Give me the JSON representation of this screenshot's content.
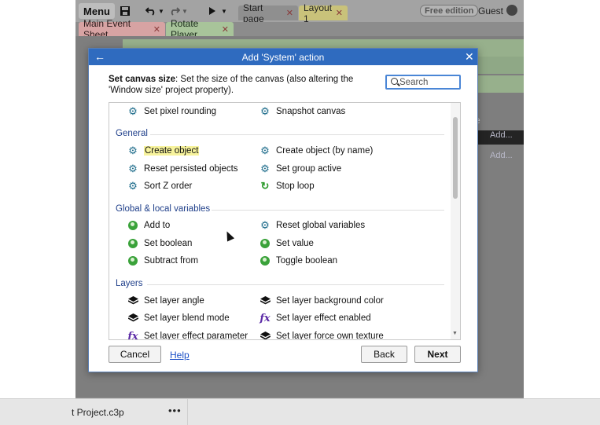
{
  "toolbar": {
    "menu_label": "Menu",
    "doc_tabs": [
      {
        "label": "Start page",
        "close": "✕"
      },
      {
        "label": "Layout 1",
        "close": "✕"
      }
    ],
    "edition_badge": "Free edition",
    "user_label": "Guest"
  },
  "sheet_tabs": [
    {
      "label": "Main Event Sheet",
      "close": "✕"
    },
    {
      "label": "Rotate Player",
      "close": "✕"
    }
  ],
  "background": {
    "add_1": "Add...",
    "add_2": "Add...",
    "partial_letter": "e"
  },
  "dialog": {
    "title": "Add 'System' action",
    "back_glyph": "←",
    "close_glyph": "✕",
    "description_bold": "Set canvas size",
    "description_rest": ": Set the size of the canvas (also altering the 'Window size' project property).",
    "search": {
      "placeholder": "Search",
      "value": ""
    },
    "top_items": [
      {
        "label": "Set pixel rounding",
        "icon": "gear-icon"
      },
      {
        "label": "Snapshot canvas",
        "icon": "gear-icon"
      }
    ],
    "groups": [
      {
        "title": "General",
        "items": [
          {
            "label": "Create object",
            "icon": "gear-icon",
            "highlighted": true
          },
          {
            "label": "Create object (by name)",
            "icon": "gear-icon"
          },
          {
            "label": "Reset persisted objects",
            "icon": "gear-icon"
          },
          {
            "label": "Set group active",
            "icon": "gear-icon"
          },
          {
            "label": "Sort Z order",
            "icon": "gear-icon"
          },
          {
            "label": "Stop loop",
            "icon": "loop-icon"
          }
        ]
      },
      {
        "title": "Global & local variables",
        "items": [
          {
            "label": "Add to",
            "icon": "globe-icon"
          },
          {
            "label": "Reset global variables",
            "icon": "gear-icon"
          },
          {
            "label": "Set boolean",
            "icon": "globe-icon"
          },
          {
            "label": "Set value",
            "icon": "globe-icon"
          },
          {
            "label": "Subtract from",
            "icon": "globe-icon"
          },
          {
            "label": "Toggle boolean",
            "icon": "globe-icon"
          }
        ]
      },
      {
        "title": "Layers",
        "items": [
          {
            "label": "Set layer angle",
            "icon": "layers-icon"
          },
          {
            "label": "Set layer background color",
            "icon": "layers-icon"
          },
          {
            "label": "Set layer blend mode",
            "icon": "layers-icon"
          },
          {
            "label": "Set layer effect enabled",
            "icon": "fx-icon"
          },
          {
            "label": "Set layer effect parameter",
            "icon": "fx-icon"
          },
          {
            "label": "Set layer force own texture",
            "icon": "layers-icon"
          }
        ]
      }
    ],
    "buttons": {
      "cancel": "Cancel",
      "help": "Help",
      "back": "Back",
      "next": "Next"
    }
  },
  "statusbar": {
    "project_name": "t Project.c3p",
    "more": "•••"
  },
  "colors": {
    "accent": "#2f6bbf",
    "group_title": "#1f3f8a",
    "highlight": "#f7f39c"
  }
}
